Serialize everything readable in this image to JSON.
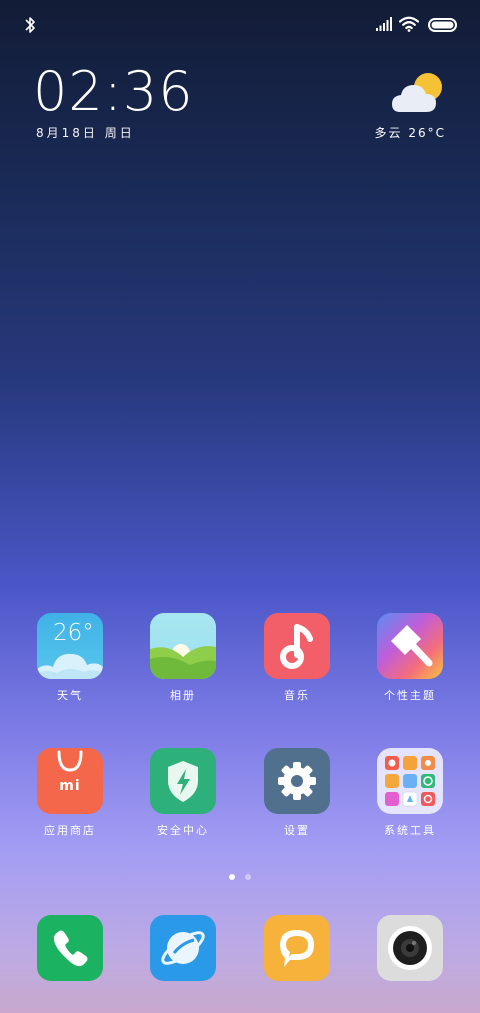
{
  "status_bar": {
    "icons": [
      "bluetooth-icon",
      "signal-icon",
      "wifi-icon",
      "battery-icon"
    ]
  },
  "clock": {
    "time": "02:36",
    "date": "8月18日 周日"
  },
  "weather_widget": {
    "icon": "partly-cloudy-icon",
    "condition": "多云",
    "temp": "26°C"
  },
  "apps": [
    {
      "label": "天气",
      "icon": "weather-icon",
      "badge": "26°"
    },
    {
      "label": "相册",
      "icon": "gallery-icon"
    },
    {
      "label": "音乐",
      "icon": "music-note-icon"
    },
    {
      "label": "个性主题",
      "icon": "theme-brush-icon"
    },
    {
      "label": "应用商店",
      "icon": "shopping-bag-icon",
      "badge": "mi"
    },
    {
      "label": "安全中心",
      "icon": "shield-bolt-icon"
    },
    {
      "label": "设置",
      "icon": "gear-icon"
    },
    {
      "label": "系统工具",
      "icon": "folder-icon"
    }
  ],
  "page_indicator": {
    "pages": 2,
    "current": 1
  },
  "dock": [
    {
      "icon": "phone-icon"
    },
    {
      "icon": "browser-icon"
    },
    {
      "icon": "message-icon"
    },
    {
      "icon": "camera-icon"
    }
  ]
}
